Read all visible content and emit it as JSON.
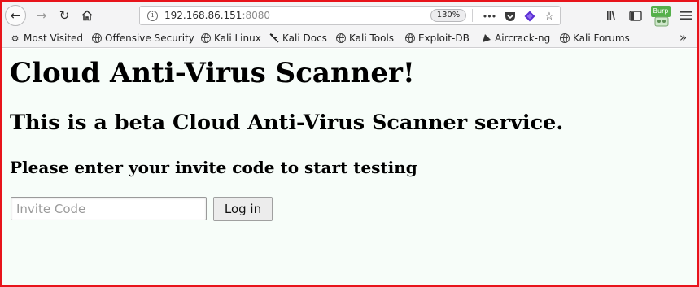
{
  "browser": {
    "url_host": "192.168.86.151",
    "url_port": ":8080",
    "zoom": "130%",
    "more_icon": "•••",
    "burp_label": "Burp",
    "overflow_icon": "»"
  },
  "bookmarks": [
    {
      "label": "Most Visited",
      "icon": "gear-icon"
    },
    {
      "label": "Offensive Security",
      "icon": "globe-icon"
    },
    {
      "label": "Kali Linux",
      "icon": "globe-icon"
    },
    {
      "label": "Kali Docs",
      "icon": "kali-icon"
    },
    {
      "label": "Kali Tools",
      "icon": "globe-icon"
    },
    {
      "label": "Exploit-DB",
      "icon": "globe-icon"
    },
    {
      "label": "Aircrack-ng",
      "icon": "aircrack-icon"
    },
    {
      "label": "Kali Forums",
      "icon": "globe-icon"
    }
  ],
  "page": {
    "title": "Cloud Anti-Virus Scanner!",
    "subtitle": "This is a beta Cloud Anti-Virus Scanner service.",
    "prompt": "Please enter your invite code to start testing",
    "invite_placeholder": "Invite Code",
    "login_label": "Log in"
  }
}
